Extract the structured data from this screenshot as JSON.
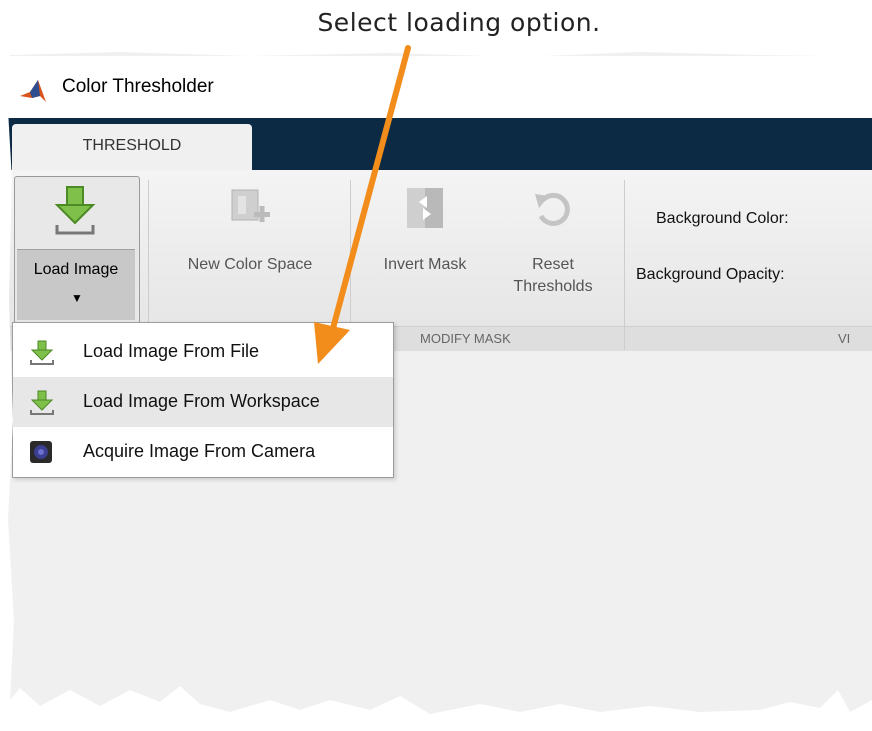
{
  "callout": {
    "text": "Select loading option."
  },
  "window": {
    "title": "Color Thresholder"
  },
  "tabs": [
    {
      "label": "THRESHOLD",
      "active": true
    }
  ],
  "toolstrip": {
    "load_button": {
      "label": "Load Image",
      "icon": "download-arrow-icon"
    },
    "new_color_space": {
      "label": "New Color Space",
      "icon": "new-color-space-icon",
      "enabled": false
    },
    "invert_mask": {
      "label": "Invert Mask",
      "icon": "invert-mask-icon",
      "enabled": false
    },
    "reset_thresholds": {
      "label_line1": "Reset",
      "label_line2": "Thresholds",
      "icon": "reset-icon",
      "enabled": false
    },
    "background_color_label": "Background Color:",
    "background_opacity_label": "Background Opacity:"
  },
  "sections": {
    "modify_mask": "MODIFY MASK",
    "view_partial": "VI"
  },
  "load_menu": {
    "items": [
      {
        "label": "Load Image From File",
        "icon": "download-arrow-icon"
      },
      {
        "label": "Load Image From Workspace",
        "icon": "download-arrow-icon",
        "highlighted": true
      },
      {
        "label": "Acquire Image From Camera",
        "icon": "camera-icon"
      }
    ]
  },
  "colors": {
    "accent_arrow": "#f28c1a",
    "tab_strip": "#0d2a45"
  }
}
